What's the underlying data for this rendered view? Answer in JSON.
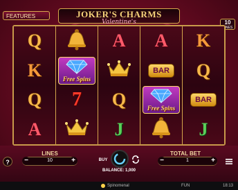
{
  "game": {
    "features_label": "FEATURES",
    "title": "JOKER'S CHARMS",
    "subtitle": "Valentine's",
    "lines_badge_number": "10",
    "lines_badge_label": "LINES"
  },
  "reels": [
    [
      "Q",
      "K",
      "Q",
      "A"
    ],
    [
      "bell",
      "free-spins",
      "7",
      "crown"
    ],
    [
      "A",
      "crown",
      "Q",
      "J"
    ],
    [
      "A",
      "BAR",
      "free-spins",
      "bell"
    ],
    [
      "K",
      "Q",
      "BAR",
      "J"
    ]
  ],
  "symbols": {
    "free_spins_text": "Free Spins",
    "bar_text": "BAR"
  },
  "controls": {
    "help_label": "?",
    "lines_label": "LINES",
    "lines_value": "10",
    "minus": "−",
    "plus": "+",
    "buy_label": "BUY",
    "total_bet_label": "TOTAL BET",
    "total_bet_value": "1",
    "balance_text": "BALANCE: 1,000"
  },
  "status": {
    "brand": "Spinomenal",
    "mode": "FUN",
    "time": "18:13"
  },
  "colors": {
    "accent_gold": "#d6a84c",
    "background": "#6a0b22"
  }
}
